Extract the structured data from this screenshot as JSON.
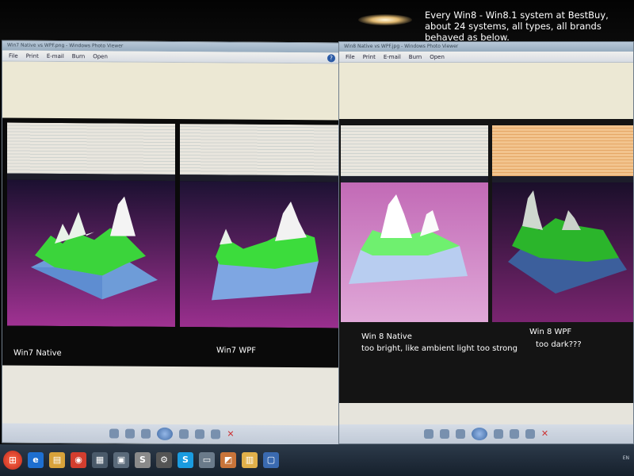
{
  "annotation": {
    "top_note": "Every Win8 - Win8.1 system at BestBuy, about 24 systems, all types, all brands behaved as below."
  },
  "viewer_left": {
    "title": "Win7 Native vs WPF.png - Windows Photo Viewer",
    "menu": [
      "File",
      "Print",
      "E-mail",
      "Burn",
      "Open"
    ],
    "help_label": "?",
    "captions": {
      "native": "Win7 Native",
      "wpf": "Win7 WPF"
    }
  },
  "viewer_right": {
    "title": "Win8 Native vs WPF.jpg - Windows Photo Viewer",
    "menu": [
      "File",
      "Print",
      "E-mail",
      "Burn",
      "Open"
    ],
    "captions": {
      "native_title": "Win 8 Native",
      "native_note": "too bright, like ambient light too strong",
      "wpf_title": "Win 8 WPF",
      "wpf_note": "too dark???"
    }
  },
  "colors": {
    "plot_magenta_left": "#8a2a7a",
    "plot_magenta_right": "#7a2570",
    "surface_green": "#3fdc3f",
    "surface_blue": "#7fa8e0",
    "surface_peak": "#f0f0f0"
  },
  "taskbar": {
    "start_icon": "windows-start-orb",
    "apps": [
      "ie-icon",
      "explorer-icon",
      "chrome-icon",
      "app-icon",
      "app-icon",
      "s-app-icon",
      "settings-icon",
      "skype-icon",
      "window-icon",
      "photo-icon",
      "folder-icon",
      "monitor-icon"
    ],
    "app_glyphs": [
      "e",
      "▤",
      "◉",
      "▦",
      "▣",
      "S",
      "⚙",
      "S",
      "▭",
      "◩",
      "▥",
      "▢"
    ],
    "tray_lang": "EN"
  }
}
